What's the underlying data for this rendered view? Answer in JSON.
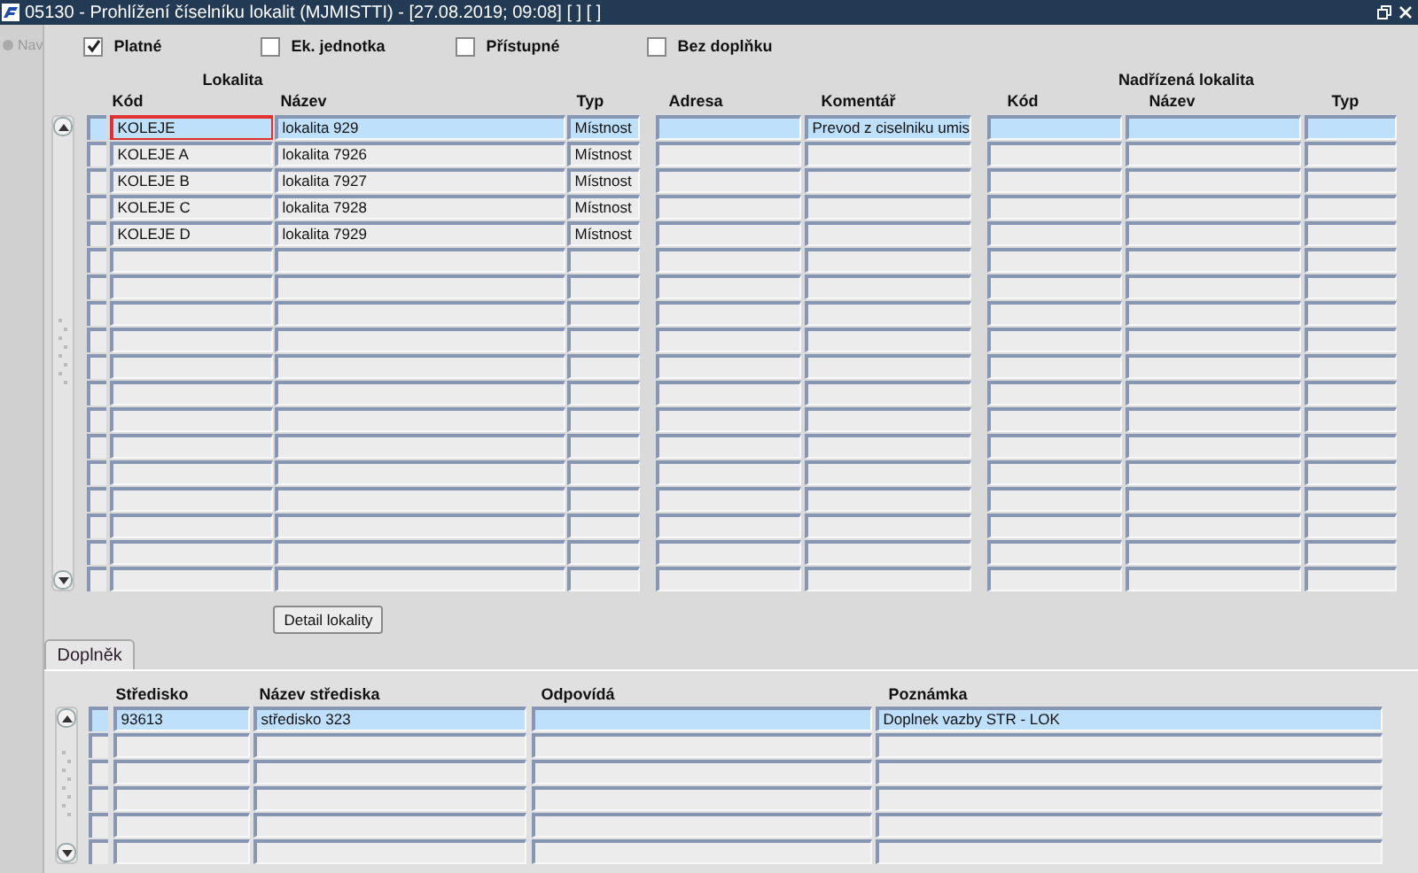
{
  "window": {
    "title": "05130 - Prohlížení číselníku lokalit (MJMISTTI) - [27.08.2019; 09:08] [ ] [ ]"
  },
  "nav": {
    "label": "Nav",
    "disabled": true
  },
  "filters": [
    {
      "label": "Platné",
      "checked": true
    },
    {
      "label": "Ek. jednotka",
      "checked": false
    },
    {
      "label": "Přístupné",
      "checked": false
    },
    {
      "label": "Bez doplňku",
      "checked": false
    }
  ],
  "lokality": {
    "group_headers": [
      "Lokalita",
      "Nadřízená lokalita"
    ],
    "columns": [
      "Kód",
      "Název",
      "Typ",
      "Adresa",
      "Komentář",
      "Kód",
      "Název",
      "Typ"
    ],
    "rows": [
      {
        "cells": [
          "KOLEJE",
          "lokalita 929",
          "Místnost",
          null,
          "Prevod z ciselniku umis",
          null,
          null,
          null
        ],
        "selected": true,
        "focused": true
      },
      {
        "cells": [
          "KOLEJE A",
          "lokalita 7926",
          "Místnost",
          null,
          null,
          null,
          null,
          null
        ],
        "selected": false,
        "focused": false
      },
      {
        "cells": [
          "KOLEJE B",
          "lokalita 7927",
          "Místnost",
          null,
          null,
          null,
          null,
          null
        ],
        "selected": false,
        "focused": false
      },
      {
        "cells": [
          "KOLEJE C",
          "lokalita 7928",
          "Místnost",
          null,
          null,
          null,
          null,
          null
        ],
        "selected": false,
        "focused": false
      },
      {
        "cells": [
          "KOLEJE D",
          "lokalita 7929",
          "Místnost",
          null,
          null,
          null,
          null,
          null
        ],
        "selected": false,
        "focused": false
      }
    ]
  },
  "detail_button": "Detail lokality",
  "tabs": [
    {
      "label": "Doplněk",
      "selected": true
    }
  ],
  "doplnek": {
    "columns": [
      "Středisko",
      "Název střediska",
      "Odpovídá",
      "Poznámka"
    ],
    "rows": [
      {
        "cells": [
          "93613",
          "středisko 323",
          null,
          "Doplnek vazby STR - LOK"
        ],
        "selected": true
      }
    ]
  }
}
